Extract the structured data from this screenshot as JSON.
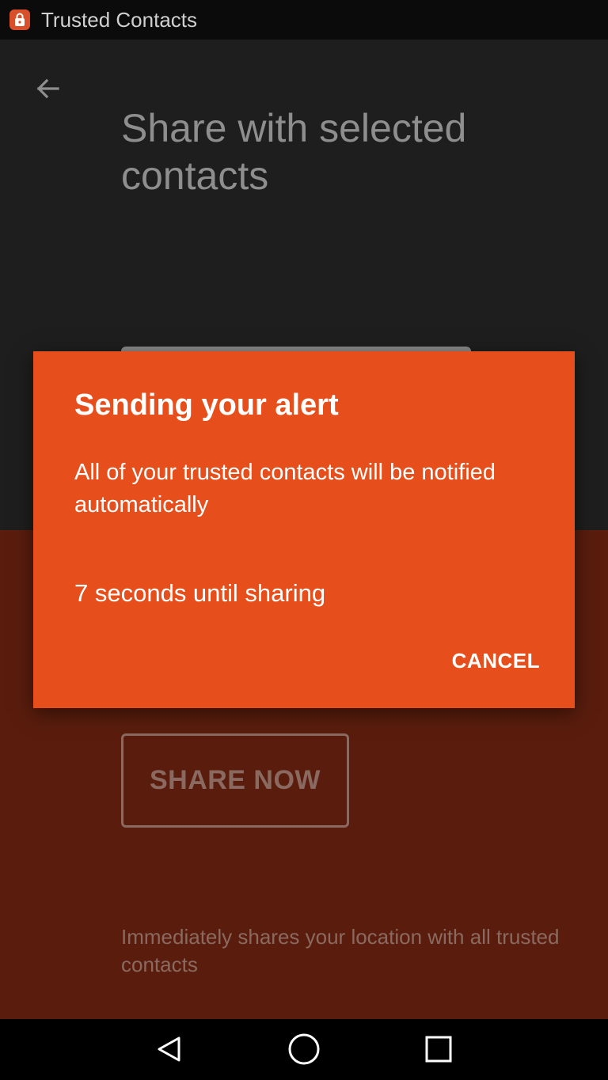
{
  "status_bar": {
    "title": "Trusted Contacts"
  },
  "header": {
    "back_icon": "arrow-left-icon",
    "title": "Share with selected contacts"
  },
  "share_now": {
    "label": "SHARE NOW",
    "description": "Immediately shares your location with all trusted contacts"
  },
  "dialog": {
    "title": "Sending your alert",
    "message": "All of your trusted contacts will be notified automatically",
    "countdown": "7 seconds until sharing",
    "cancel_label": "CANCEL",
    "accent_color": "#e64f1c"
  },
  "nav_bar": {
    "back_icon": "nav-back-icon",
    "home_icon": "nav-home-icon",
    "recents_icon": "nav-recents-icon"
  }
}
